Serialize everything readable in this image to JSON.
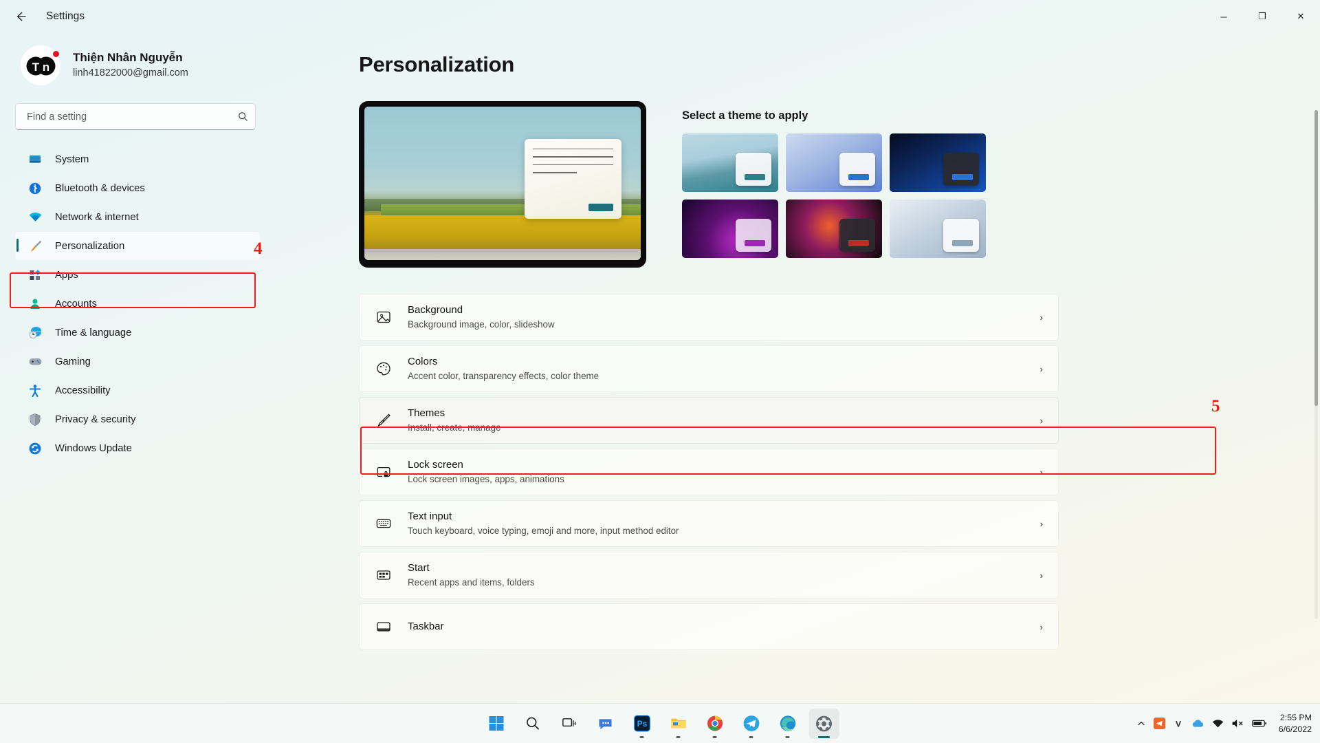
{
  "window": {
    "title": "Settings",
    "back_icon": "back-arrow-icon",
    "minimize_label": "─",
    "maximize_label": "❐",
    "close_label": "✕"
  },
  "profile": {
    "name": "Thiện Nhân Nguyễn",
    "email": "linh41822000@gmail.com",
    "avatar_initials": "TN"
  },
  "search": {
    "placeholder": "Find a setting",
    "value": "",
    "icon": "search-icon"
  },
  "sidebar": {
    "items": [
      {
        "label": "System",
        "icon": "system-icon",
        "active": false
      },
      {
        "label": "Bluetooth & devices",
        "icon": "bluetooth-icon",
        "active": false
      },
      {
        "label": "Network & internet",
        "icon": "wifi-icon",
        "active": false
      },
      {
        "label": "Personalization",
        "icon": "paintbrush-icon",
        "active": true
      },
      {
        "label": "Apps",
        "icon": "apps-icon",
        "active": false
      },
      {
        "label": "Accounts",
        "icon": "person-icon",
        "active": false
      },
      {
        "label": "Time & language",
        "icon": "globe-clock-icon",
        "active": false
      },
      {
        "label": "Gaming",
        "icon": "gamepad-icon",
        "active": false
      },
      {
        "label": "Accessibility",
        "icon": "accessibility-icon",
        "active": false
      },
      {
        "label": "Privacy & security",
        "icon": "shield-icon",
        "active": false
      },
      {
        "label": "Windows Update",
        "icon": "update-icon",
        "active": false
      }
    ]
  },
  "main": {
    "page_title": "Personalization",
    "themes_heading": "Select a theme to apply",
    "themes": [
      {
        "name": "theme-lake-light",
        "style": "t1",
        "dark": false,
        "accent": "#2e7f8c"
      },
      {
        "name": "theme-windows-light",
        "style": "t2",
        "dark": false,
        "accent": "#2f6fd0"
      },
      {
        "name": "theme-windows-dark",
        "style": "t3",
        "dark": true,
        "accent": "#2a6fd8"
      },
      {
        "name": "theme-glow-purple",
        "style": "t4",
        "dark": true,
        "accent": "#9b2bb5"
      },
      {
        "name": "theme-flow-dark",
        "style": "t5",
        "dark": true,
        "accent": "#c42727"
      },
      {
        "name": "theme-waves-light",
        "style": "t6",
        "dark": false,
        "accent": "#8ea6ba"
      }
    ],
    "settings": [
      {
        "title": "Background",
        "subtitle": "Background image, color, slideshow",
        "icon": "image-icon",
        "highlighted": false
      },
      {
        "title": "Colors",
        "subtitle": "Accent color, transparency effects, color theme",
        "icon": "palette-icon",
        "highlighted": false
      },
      {
        "title": "Themes",
        "subtitle": "Install, create, manage",
        "icon": "paintbrush-icon",
        "highlighted": true
      },
      {
        "title": "Lock screen",
        "subtitle": "Lock screen images, apps, animations",
        "icon": "lock-screen-icon",
        "highlighted": false
      },
      {
        "title": "Text input",
        "subtitle": "Touch keyboard, voice typing, emoji and more, input method editor",
        "icon": "keyboard-icon",
        "highlighted": false
      },
      {
        "title": "Start",
        "subtitle": "Recent apps and items, folders",
        "icon": "start-icon",
        "highlighted": false
      },
      {
        "title": "Taskbar",
        "subtitle": "",
        "icon": "taskbar-icon",
        "highlighted": false
      }
    ],
    "chevron": "›"
  },
  "annotations": {
    "step_sidebar": "4",
    "step_themes": "5",
    "color": "#f51a1a"
  },
  "taskbar": {
    "apps": [
      {
        "name": "start-button",
        "icon": "windows-logo-icon",
        "state": ""
      },
      {
        "name": "search-button",
        "icon": "search-icon",
        "state": ""
      },
      {
        "name": "task-view-button",
        "icon": "task-view-icon",
        "state": ""
      },
      {
        "name": "chat-button",
        "icon": "chat-icon",
        "state": ""
      },
      {
        "name": "photoshop-app",
        "icon": "photoshop-icon",
        "state": "running"
      },
      {
        "name": "file-explorer-app",
        "icon": "folder-icon",
        "state": "running"
      },
      {
        "name": "chrome-app",
        "icon": "chrome-icon",
        "state": "running"
      },
      {
        "name": "telegram-app",
        "icon": "telegram-icon",
        "state": "running"
      },
      {
        "name": "edge-app",
        "icon": "edge-icon",
        "state": "running"
      },
      {
        "name": "settings-app",
        "icon": "gear-icon",
        "state": "active"
      }
    ],
    "tray": [
      {
        "name": "show-hidden-icons",
        "icon": "chevron-up-icon"
      },
      {
        "name": "telegram-tray-icon",
        "icon": "telegram-tray-icon"
      },
      {
        "name": "v-tray-icon",
        "icon": "v-letter-icon"
      },
      {
        "name": "onedrive-tray-icon",
        "icon": "cloud-icon"
      },
      {
        "name": "network-tray-icon",
        "icon": "wifi-icon"
      },
      {
        "name": "volume-tray-icon",
        "icon": "speaker-mute-icon"
      },
      {
        "name": "battery-tray-icon",
        "icon": "battery-icon"
      }
    ],
    "clock": {
      "time": "2:55 PM",
      "date": "6/6/2022"
    }
  }
}
